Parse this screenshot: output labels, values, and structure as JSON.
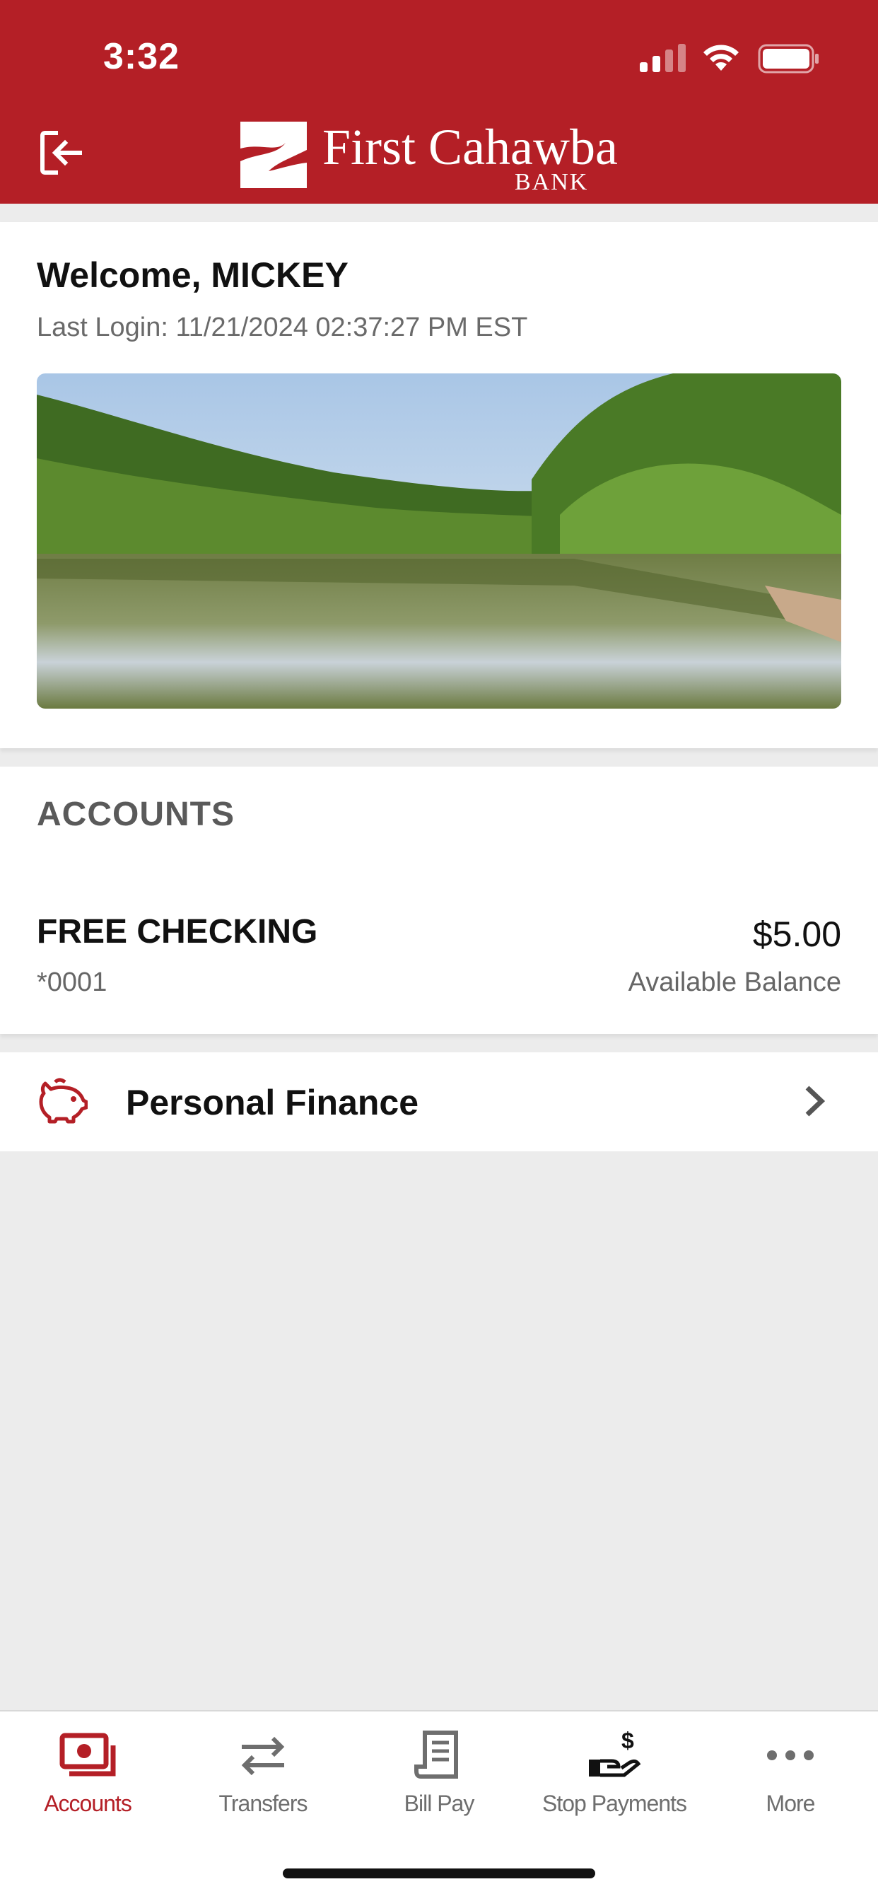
{
  "status_bar": {
    "time": "3:32"
  },
  "header": {
    "brand_name": "First Cahawba",
    "brand_sub": "BANK"
  },
  "welcome": {
    "title": "Welcome, MICKEY",
    "last_login": "Last Login: 11/21/2024 02:37:27 PM EST"
  },
  "accounts": {
    "heading": "ACCOUNTS",
    "items": [
      {
        "name": "FREE CHECKING",
        "number": "*0001",
        "balance": "$5.00",
        "balance_label": "Available Balance"
      }
    ]
  },
  "personal_finance": {
    "label": "Personal Finance"
  },
  "tabbar": {
    "tabs": [
      {
        "label": "Accounts",
        "icon": "accounts-icon",
        "active": true
      },
      {
        "label": "Transfers",
        "icon": "transfers-icon",
        "active": false
      },
      {
        "label": "Bill Pay",
        "icon": "bill-pay-icon",
        "active": false
      },
      {
        "label": "Stop Payments",
        "icon": "stop-payments-icon",
        "active": false
      },
      {
        "label": "More",
        "icon": "more-icon",
        "active": false
      }
    ]
  },
  "colors": {
    "brand": "#b41f26",
    "background": "#ececec",
    "inactive_tab": "#6e6e6e"
  }
}
